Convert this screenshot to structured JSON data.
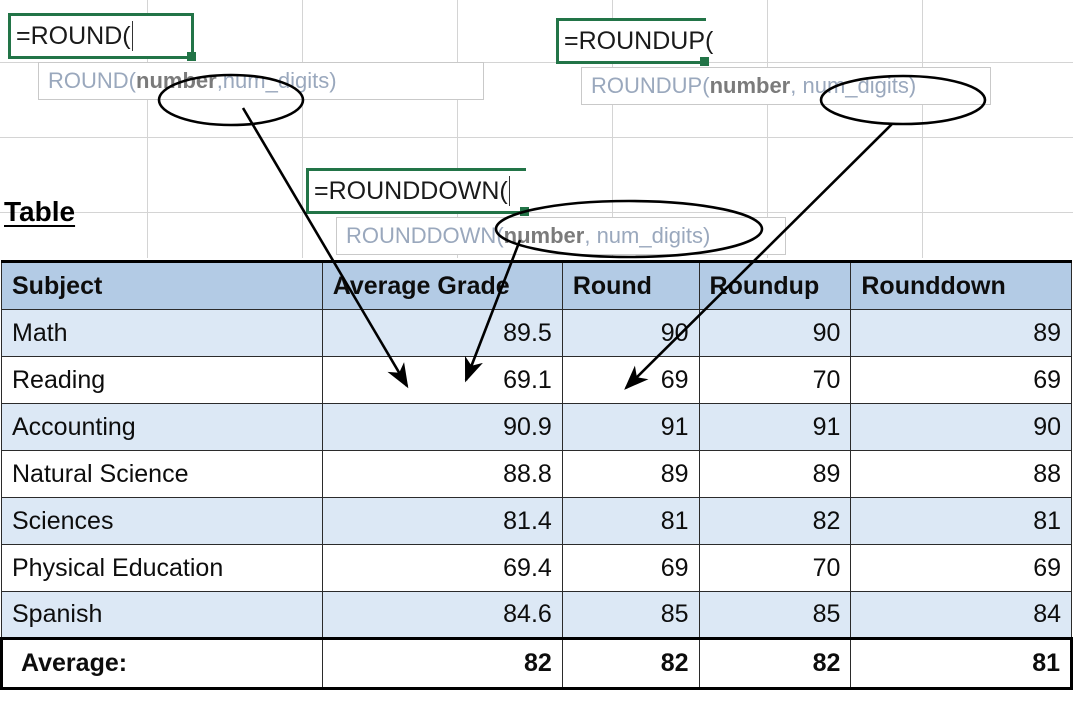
{
  "app": {
    "type": "spreadsheet-worksheet",
    "accent_green": "#227447",
    "header_fill": "#b3cbe5",
    "banded_fill": "#dce8f5",
    "tooltip_text_color": "#9aa8bd"
  },
  "formulas": [
    {
      "id": "round",
      "cell_text": "=ROUND(",
      "tooltip_prefix": "ROUND(",
      "tooltip_arg_bold": "number",
      "tooltip_suffix": ",num_digits)",
      "tooltip_full": "ROUND(number,num_digits)"
    },
    {
      "id": "roundup",
      "cell_text": "=ROUNDUP(",
      "tooltip_prefix": "ROUNDUP(",
      "tooltip_arg_bold": "number",
      "tooltip_suffix": ", num_digits)",
      "tooltip_full": "ROUNDUP(number, num_digits)"
    },
    {
      "id": "rounddown",
      "cell_text": "=ROUNDDOWN(",
      "tooltip_prefix": "ROUNDDOWN(",
      "tooltip_arg_bold": "number",
      "tooltip_suffix": ", num_digits)",
      "tooltip_full": "ROUNDDOWN(number, num_digits)"
    }
  ],
  "heading": "Table",
  "table": {
    "columns": [
      "Subject",
      "Average Grade",
      "Round",
      "Roundup",
      "Rounddown"
    ],
    "rows": [
      {
        "subject": "Math",
        "average_grade": "89.5",
        "round": "90",
        "roundup": "90",
        "rounddown": "89"
      },
      {
        "subject": "Reading",
        "average_grade": "69.1",
        "round": "69",
        "roundup": "70",
        "rounddown": "69"
      },
      {
        "subject": "Accounting",
        "average_grade": "90.9",
        "round": "91",
        "roundup": "91",
        "rounddown": "90"
      },
      {
        "subject": "Natural Science",
        "average_grade": "88.8",
        "round": "89",
        "roundup": "89",
        "rounddown": "88"
      },
      {
        "subject": "Sciences",
        "average_grade": "81.4",
        "round": "81",
        "roundup": "82",
        "rounddown": "81"
      },
      {
        "subject": "Physical Education",
        "average_grade": "69.4",
        "round": "69",
        "roundup": "70",
        "rounddown": "69"
      },
      {
        "subject": "Spanish",
        "average_grade": "84.6",
        "round": "85",
        "roundup": "85",
        "rounddown": "84"
      }
    ],
    "total_row": {
      "label": "Average:",
      "average_grade": "82",
      "round": "82",
      "roundup": "82",
      "rounddown": "81"
    }
  },
  "annotations": {
    "ellipses": [
      {
        "id": "round-number-ellipse",
        "target": "number"
      },
      {
        "id": "roundup-numdigits-ellipse",
        "target": "num_digits"
      },
      {
        "id": "rounddown-args-ellipse",
        "target": "(number, num_digits)"
      }
    ],
    "arrows": [
      {
        "id": "round-arrow",
        "from": "round-number-ellipse",
        "to": "Average Grade column, Reading row"
      },
      {
        "id": "rounddown-arrow",
        "from": "rounddown-args-ellipse",
        "to": "Average Grade column, Reading row"
      },
      {
        "id": "roundup-arrow",
        "from": "roundup-numdigits-ellipse",
        "to": "Round column, Reading row"
      }
    ]
  }
}
